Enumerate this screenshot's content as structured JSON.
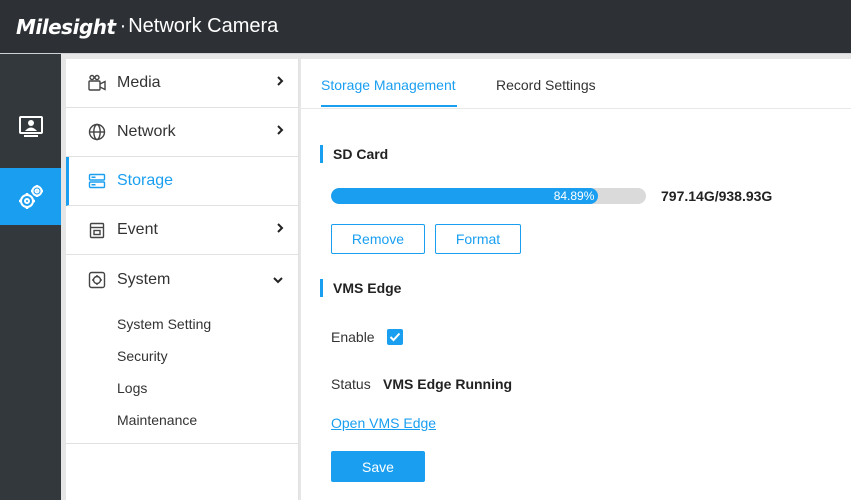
{
  "header": {
    "brand": "Milesight",
    "product": "Network Camera"
  },
  "rail": {
    "items": [
      {
        "icon": "live-view-icon",
        "active": false
      },
      {
        "icon": "settings-gears-icon",
        "active": true
      }
    ],
    "active_color": "#1a9ff0"
  },
  "menu": {
    "items": [
      {
        "label": "Media",
        "icon": "media-camera-icon",
        "has_arrow": true
      },
      {
        "label": "Network",
        "icon": "globe-icon",
        "has_arrow": true
      },
      {
        "label": "Storage",
        "icon": "storage-icon",
        "active": true
      },
      {
        "label": "Event",
        "icon": "event-icon",
        "has_arrow": true
      },
      {
        "label": "System",
        "icon": "system-icon",
        "expanded": true
      }
    ],
    "system_sub": [
      {
        "label": "System Setting"
      },
      {
        "label": "Security"
      },
      {
        "label": "Logs"
      },
      {
        "label": "Maintenance"
      }
    ]
  },
  "tabs": [
    {
      "label": "Storage Management",
      "active": true
    },
    {
      "label": "Record Settings",
      "active": false
    }
  ],
  "sd_card": {
    "title": "SD Card",
    "usage_percent_text": "84.89%",
    "usage_fraction": 0.8489,
    "capacity": "797.14G/938.93G",
    "remove_label": "Remove",
    "format_label": "Format"
  },
  "vms_edge": {
    "title": "VMS Edge",
    "enable_label": "Enable",
    "enabled": true,
    "status_label": "Status",
    "status_value": "VMS Edge Running",
    "open_link": "Open VMS Edge",
    "save_label": "Save"
  },
  "colors": {
    "accent": "#1a9ff0",
    "header_bg": "#2d3136",
    "rail_bg": "#33383d"
  }
}
